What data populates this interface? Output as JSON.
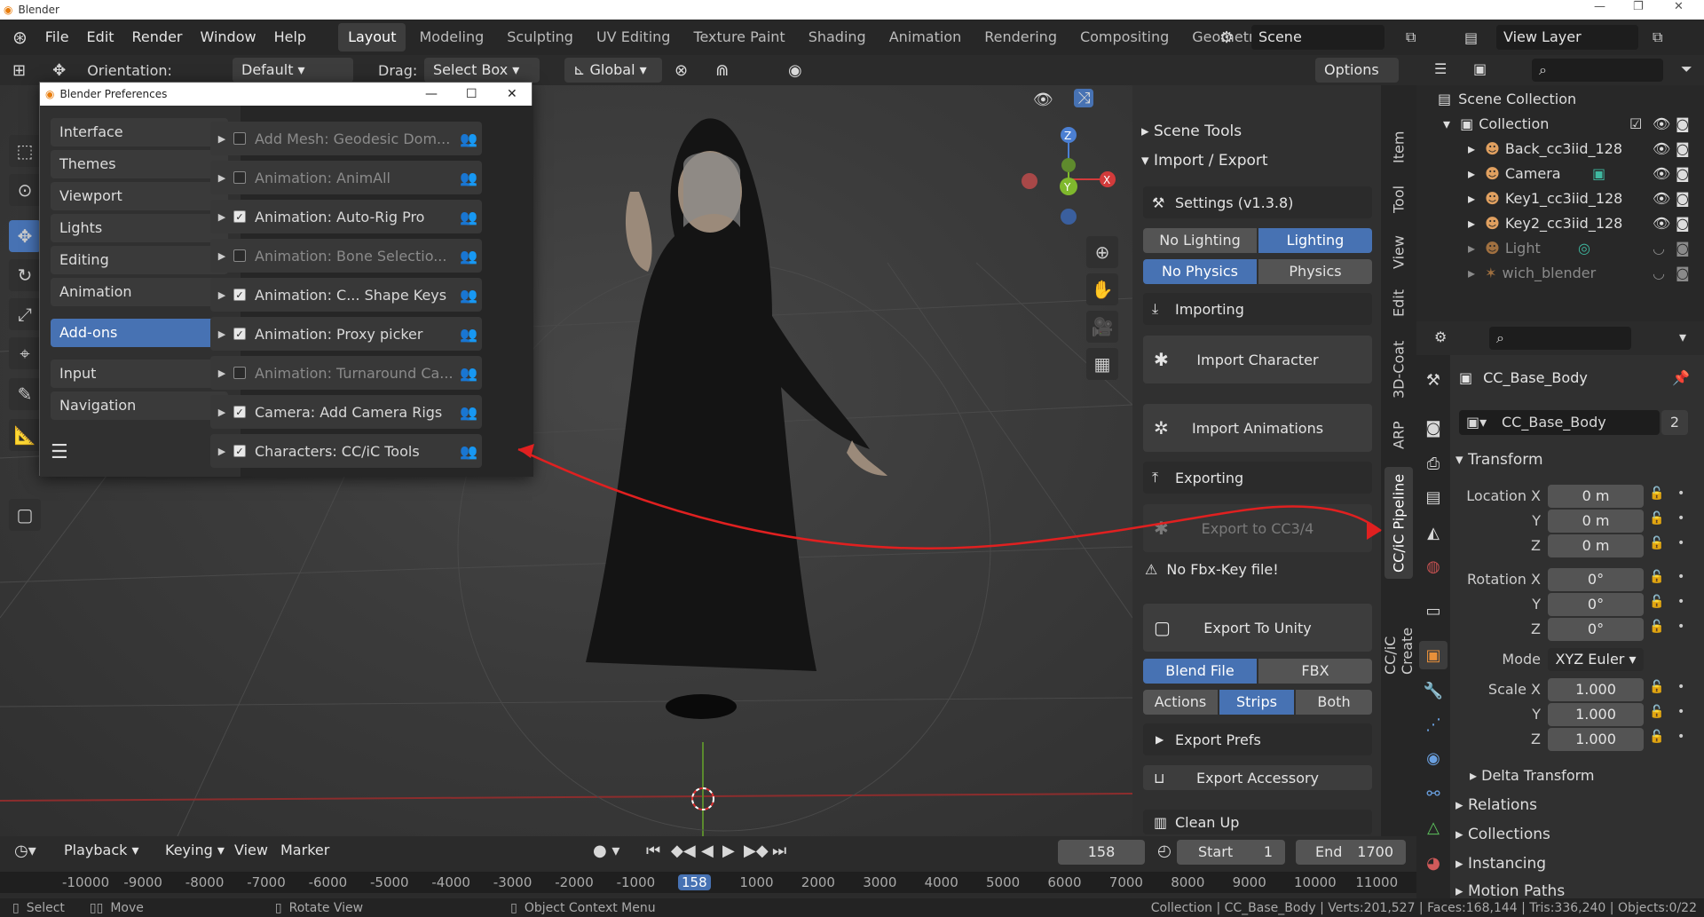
{
  "titlebar": {
    "title": "Blender",
    "min": "—",
    "max": "❐",
    "close": "✕"
  },
  "menu": {
    "items": [
      "File",
      "Edit",
      "Render",
      "Window",
      "Help"
    ]
  },
  "workspaces": [
    "Layout",
    "Modeling",
    "Sculpting",
    "UV Editing",
    "Texture Paint",
    "Shading",
    "Animation",
    "Rendering",
    "Compositing",
    "Geometry"
  ],
  "scene": "Scene",
  "view_layer": "View Layer",
  "header": {
    "orientation_label": "Orientation:",
    "orientation": "Default",
    "drag_label": "Drag:",
    "drag": "Select Box",
    "transform": "Global",
    "options": "Options"
  },
  "prefs": {
    "title": "Blender Preferences",
    "categories": [
      "Interface",
      "Themes",
      "Viewport",
      "Lights",
      "Editing",
      "Animation",
      "Add-ons",
      "Input",
      "Navigation"
    ],
    "active": "Add-ons",
    "addons": [
      {
        "label": "Add Mesh: Geodesic Dom...",
        "on": false
      },
      {
        "label": "Animation: AnimAll",
        "on": false
      },
      {
        "label": "Animation: Auto-Rig Pro",
        "on": true
      },
      {
        "label": "Animation: Bone Selectio...",
        "on": false
      },
      {
        "label": "Animation: C... Shape Keys",
        "on": true
      },
      {
        "label": "Animation: Proxy picker",
        "on": true
      },
      {
        "label": "Animation: Turnaround Ca...",
        "on": false
      },
      {
        "label": "Camera: Add Camera Rigs",
        "on": true
      },
      {
        "label": "Characters: CC/iC Tools",
        "on": true
      }
    ]
  },
  "npanel": {
    "scene_tools": "Scene Tools",
    "import_export": "Import / Export",
    "settings": "Settings  (v1.3.8)",
    "lighting": [
      "No Lighting",
      "Lighting"
    ],
    "physics": [
      "No Physics",
      "Physics"
    ],
    "importing": "Importing",
    "import_character": "Import Character",
    "import_animations": "Import Animations",
    "exporting": "Exporting",
    "export_cc": "Export to CC3/4",
    "no_fbx": "No Fbx-Key file!",
    "export_unity": "Export To Unity",
    "format": [
      "Blend File",
      "FBX"
    ],
    "strips": [
      "Actions",
      "Strips",
      "Both"
    ],
    "export_prefs": "Export Prefs",
    "export_accessory": "Export Accessory",
    "clean_up": "Clean Up",
    "tabs": [
      "Item",
      "Tool",
      "View",
      "Edit",
      "3D-Coat",
      "ARP",
      "CC/iC Pipeline",
      "CC/iC Create"
    ]
  },
  "outliner": {
    "root": "Scene Collection",
    "collection": "Collection",
    "items": [
      "Back_cc3iid_128",
      "Camera",
      "Key1_cc3iid_128",
      "Key2_cc3iid_128",
      "Light",
      "wich_blender"
    ]
  },
  "properties": {
    "object": "CC_Base_Body",
    "data": "CC_Base_Body",
    "users": "2",
    "transform": "Transform",
    "location_label": "Location X",
    "location": [
      "0 m",
      "0 m",
      "0 m"
    ],
    "rotation_label": "Rotation X",
    "rotation": [
      "0°",
      "0°",
      "0°"
    ],
    "mode_label": "Mode",
    "mode": "XYZ Euler",
    "scale_label": "Scale X",
    "scale": [
      "1.000",
      "1.000",
      "1.000"
    ],
    "axis_y": "Y",
    "axis_z": "Z",
    "sections": [
      "Delta Transform",
      "Relations",
      "Collections",
      "Instancing",
      "Motion Paths"
    ]
  },
  "timeline": {
    "menus": [
      "Playback",
      "Keying",
      "View",
      "Marker"
    ],
    "frame": "158",
    "start_label": "Start",
    "start": "1",
    "end_label": "End",
    "end": "1700",
    "ruler": [
      "-10000",
      "-9000",
      "-8000",
      "-7000",
      "-6000",
      "-5000",
      "-4000",
      "-3000",
      "-2000",
      "-1000",
      "158",
      "1000",
      "2000",
      "3000",
      "4000",
      "5000",
      "6000",
      "7000",
      "8000",
      "9000",
      "10000",
      "11000"
    ]
  },
  "status": {
    "select": "Select",
    "move": "Move",
    "rotate": "Rotate View",
    "context": "Object Context Menu",
    "info": "Collection | CC_Base_Body | Verts:201,527 | Faces:168,144 | Tris:336,240 | Objects:0/22"
  }
}
